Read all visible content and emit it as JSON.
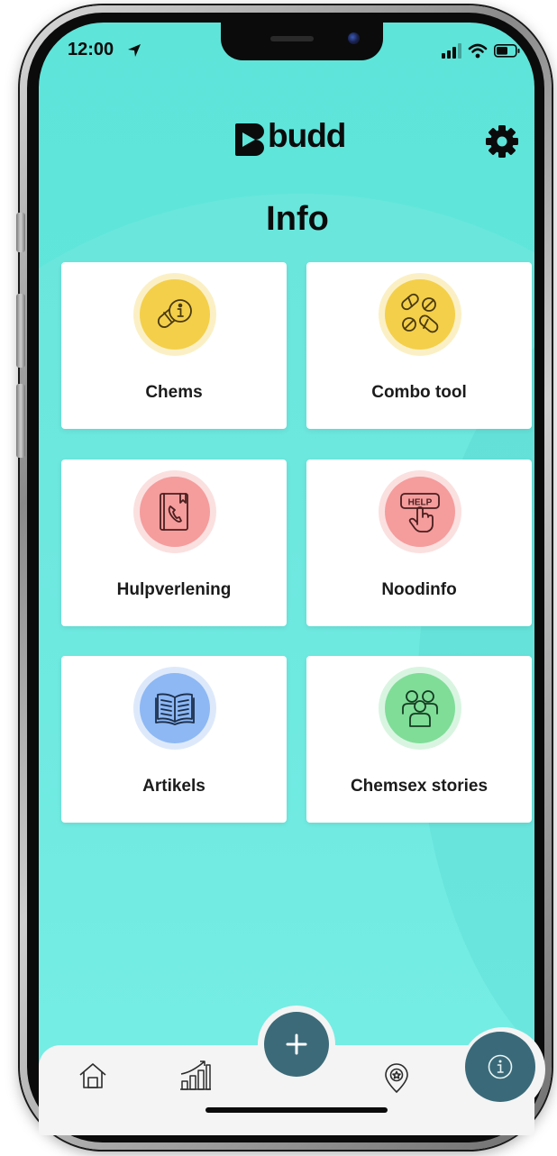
{
  "status_bar": {
    "time": "12:00",
    "icons": [
      "location-arrow-icon",
      "cellular-signal-icon",
      "wifi-icon",
      "battery-icon"
    ]
  },
  "header": {
    "logo_text": "budd",
    "settings_icon": "gear-icon"
  },
  "page_title": "Info",
  "tiles": [
    {
      "label": "Chems",
      "icon": "pill-info-icon",
      "color": "#f4cf49"
    },
    {
      "label": "Combo tool",
      "icon": "pills-combo-icon",
      "color": "#f4cf49"
    },
    {
      "label": "Hulpverlening",
      "icon": "phone-book-icon",
      "color": "#f59c9c"
    },
    {
      "label": "Noodinfo",
      "icon": "help-button-icon",
      "color": "#f59c9c",
      "icon_text": "HELP"
    },
    {
      "label": "Artikels",
      "icon": "open-book-icon",
      "color": "#8db8f4"
    },
    {
      "label": "Chemsex stories",
      "icon": "people-group-icon",
      "color": "#7fdd98"
    }
  ],
  "tab_bar": {
    "items": [
      "home-icon",
      "stats-chart-icon",
      "add-icon",
      "location-pin-icon",
      "info-icon"
    ],
    "active": "info-icon"
  },
  "colors": {
    "background": "#5ee4d9",
    "accent": "#3c6a78",
    "tile": "#ffffff"
  }
}
